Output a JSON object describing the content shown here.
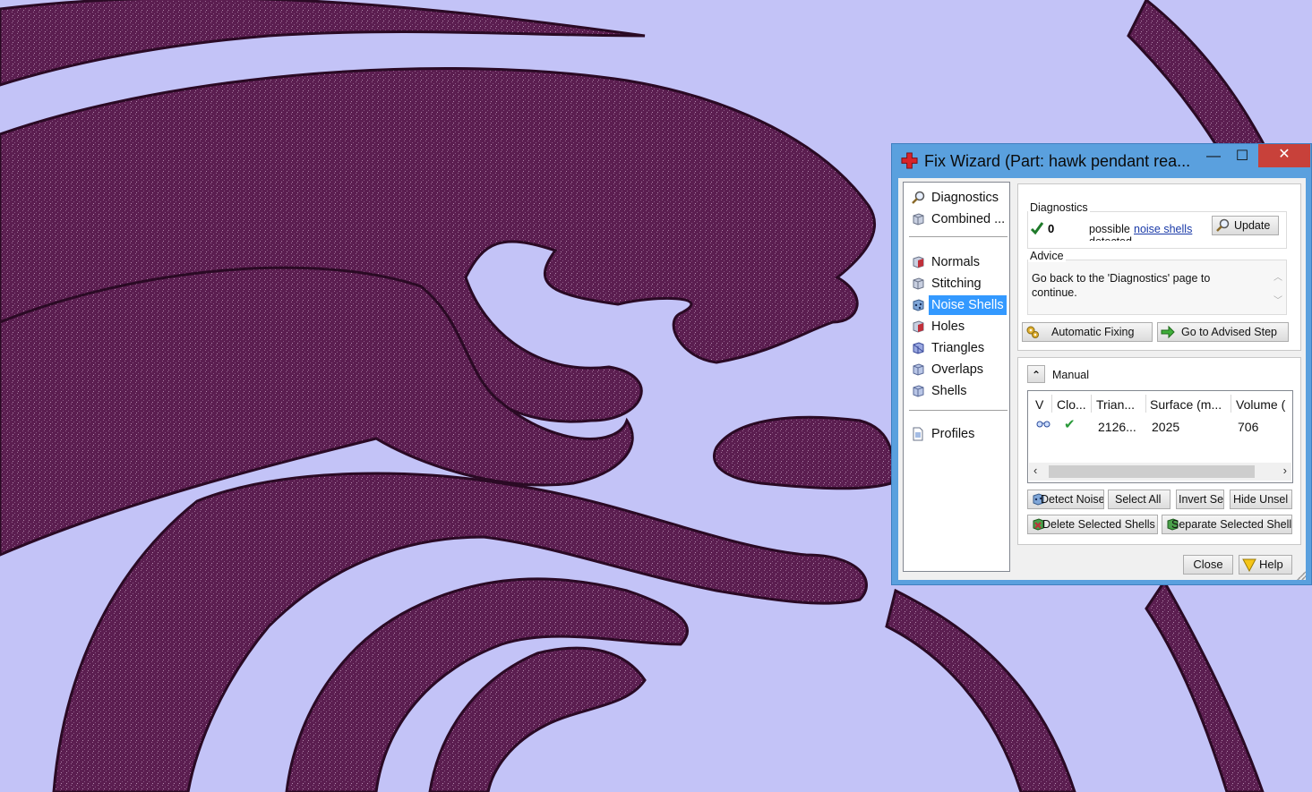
{
  "window": {
    "title": "Fix Wizard (Part: hawk pendant rea...",
    "minimize_glyph": "—",
    "maximize_glyph": "☐",
    "close_glyph": "✕"
  },
  "nav": {
    "items": [
      {
        "label": "Diagnostics",
        "icon": "magnifier-icon"
      },
      {
        "label": "Combined ...",
        "icon": "cube-icon"
      },
      {
        "label": "Normals",
        "icon": "cube-red-icon"
      },
      {
        "label": "Stitching",
        "icon": "cube-icon"
      },
      {
        "label": "Noise Shells",
        "icon": "cube-dots-icon",
        "selected": true
      },
      {
        "label": "Holes",
        "icon": "cube-red-icon"
      },
      {
        "label": "Triangles",
        "icon": "cube-blue-icon"
      },
      {
        "label": "Overlaps",
        "icon": "cube-icon"
      },
      {
        "label": "Shells",
        "icon": "cube-icon"
      },
      {
        "label": "Profiles",
        "icon": "page-icon"
      }
    ]
  },
  "diagnostics": {
    "heading": "Diagnostics",
    "count": "0",
    "text": "possible",
    "link": "noise shells",
    "overflow_text": "detected",
    "update_label": "Update"
  },
  "advice": {
    "heading": "Advice",
    "text": "Go back to the 'Diagnostics' page to continue."
  },
  "actions": {
    "automatic_fixing": "Automatic Fixing",
    "go_to_advised": "Go to Advised Step"
  },
  "manual": {
    "heading": "Manual",
    "collapse_glyph": "⌃",
    "columns": [
      "V",
      "Clo...",
      "Trian...",
      "Surface (m...",
      "Volume ("
    ],
    "rows": [
      {
        "closed": "✔",
        "triangles": "2126...",
        "surface": "2025",
        "volume": "706"
      }
    ],
    "buttons": {
      "detect_noise": "Detect Noise",
      "select_all": "Select All",
      "invert": "Invert Se",
      "hide_unsel": "Hide Unsel",
      "delete_selected": "Delete Selected Shells",
      "separate_selected": "Separate Selected Shell"
    }
  },
  "footer": {
    "close_label": "Close",
    "help_label": "Help"
  },
  "colors": {
    "background": "#c3c3f7",
    "model": "#5a1d4e",
    "window_frame": "#5aa0de",
    "close_button": "#c8413a",
    "selection": "#3399ff",
    "check": "#2a9a3a"
  }
}
